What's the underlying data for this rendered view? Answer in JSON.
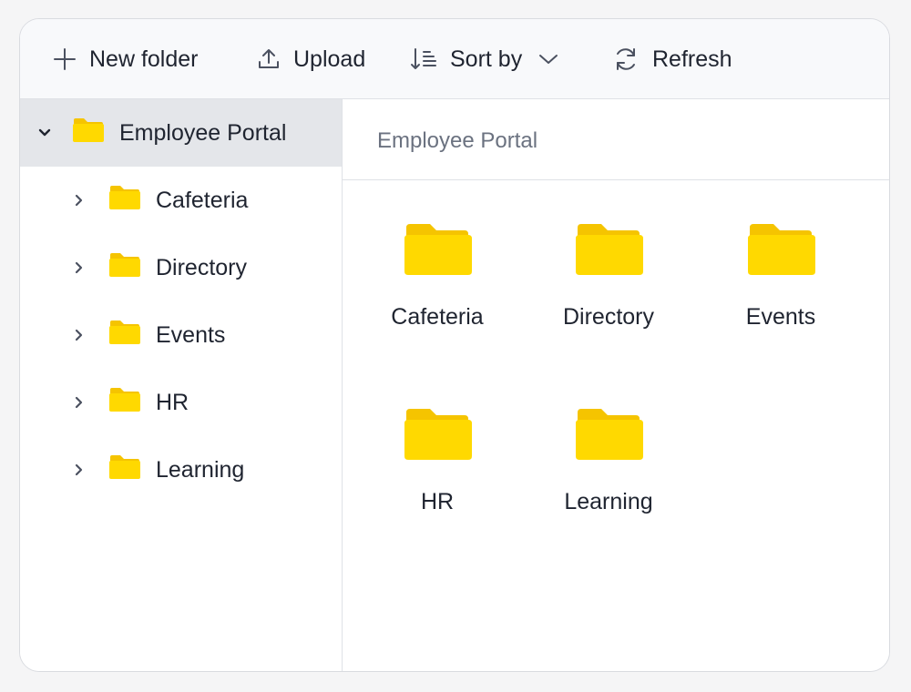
{
  "toolbar": {
    "new_folder": "New folder",
    "upload": "Upload",
    "sort_by": "Sort by",
    "refresh": "Refresh"
  },
  "tree": {
    "root": "Employee Portal",
    "children": [
      "Cafeteria",
      "Directory",
      "Events",
      "HR",
      "Learning"
    ]
  },
  "breadcrumb": "Employee Portal",
  "folders": [
    "Cafeteria",
    "Directory",
    "Events",
    "HR",
    "Learning"
  ],
  "colors": {
    "folder": "#FFD900",
    "folder_tab": "#F5C400",
    "selected_row": "#E4E6EA",
    "text": "#1F2430",
    "muted": "#6B7280"
  },
  "icons": {
    "new_folder": "plus-icon",
    "upload": "upload-icon",
    "sort": "sort-icon",
    "sort_dropdown": "chevron-down-icon",
    "refresh": "refresh-icon",
    "expanded": "chevron-down-icon",
    "collapsed": "chevron-right-icon",
    "folder": "folder-icon"
  }
}
